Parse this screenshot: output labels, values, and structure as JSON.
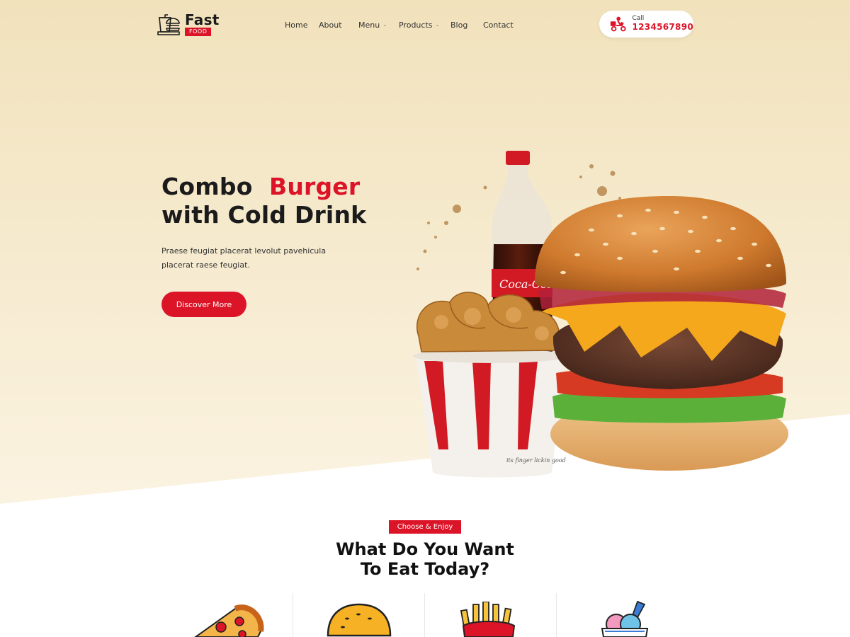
{
  "brand": {
    "name_top": "Fast",
    "name_bottom": "FOOD",
    "accent": "#dc1428",
    "hero_bg": "#f1e2bc"
  },
  "nav": {
    "items": [
      {
        "label": "Home",
        "dropdown": false
      },
      {
        "label": "About",
        "dropdown": false
      },
      {
        "label": "Menu",
        "dropdown": true
      },
      {
        "label": "Products",
        "dropdown": true
      },
      {
        "label": "Blog",
        "dropdown": false
      },
      {
        "label": "Contact",
        "dropdown": false
      }
    ]
  },
  "call": {
    "label": "Call",
    "number": "1234567890",
    "icon": "delivery-scooter-icon"
  },
  "hero": {
    "title_part1": "Combo",
    "title_highlight": "Burger",
    "title_line2": "with Cold Drink",
    "description": "Praese feugiat placerat levolut pavehicula placerat raese feugiat.",
    "button_label": "Discover More"
  },
  "section": {
    "badge": "Choose & Enjoy",
    "title_line1": "What Do You Want",
    "title_line2": "To Eat Today?",
    "categories": [
      {
        "icon": "pizza-icon"
      },
      {
        "icon": "burger-icon"
      },
      {
        "icon": "fries-icon"
      },
      {
        "icon": "ice-cream-icon"
      }
    ]
  }
}
